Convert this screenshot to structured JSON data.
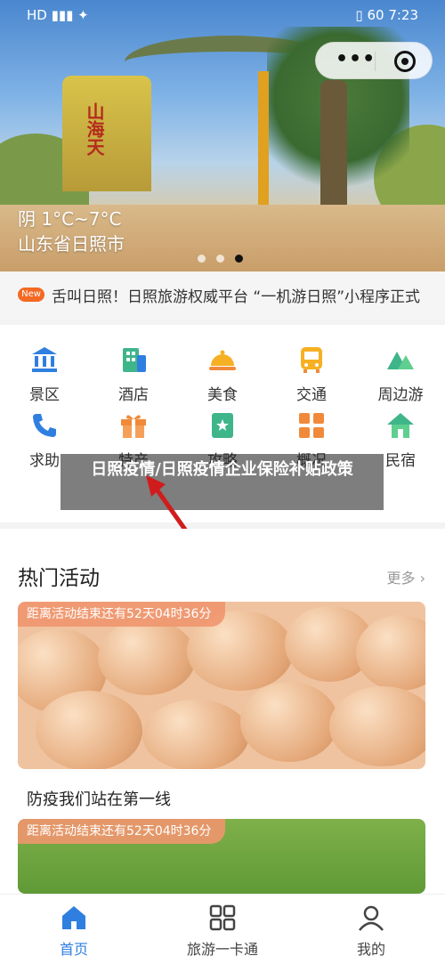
{
  "status_bar": {
    "left": "HD ▮▮▮ ✦",
    "battery": "60",
    "time": "7:23"
  },
  "capsule": {
    "menu_icon": "more-dots-icon",
    "close_icon": "target-icon"
  },
  "hero": {
    "weather": "阴 1°C~7°C",
    "city": "山东省日照市",
    "gate_text": "山海天"
  },
  "notice": {
    "badge": "New",
    "text": "舌叫日照！日照旅游权威平台 “一机游日照”小程序正式"
  },
  "grid": {
    "items": [
      {
        "label": "景区",
        "icon": "bank-icon"
      },
      {
        "label": "酒店",
        "icon": "building-icon"
      },
      {
        "label": "美食",
        "icon": "cloche-icon"
      },
      {
        "label": "交通",
        "icon": "bus-icon"
      },
      {
        "label": "周边游",
        "icon": "mountain-icon"
      },
      {
        "label": "求助",
        "icon": "phone-icon"
      },
      {
        "label": "特产",
        "icon": "gift-icon"
      },
      {
        "label": "攻略",
        "icon": "book-icon"
      },
      {
        "label": "概况",
        "icon": "tiles-icon"
      },
      {
        "label": "民宿",
        "icon": "house-icon"
      }
    ]
  },
  "overlay": {
    "text": "日照疫情/日照疫情企业保险补贴政策"
  },
  "hot": {
    "title": "热门活动",
    "more": "更多",
    "cards": [
      {
        "timer": "距离活动结束还有52天04时36分",
        "caption": "防疫我们站在第一线"
      },
      {
        "timer": "距离活动结束还有52天04时36分"
      }
    ]
  },
  "tabbar": [
    {
      "label": "首页",
      "icon": "home-icon",
      "active": true
    },
    {
      "label": "旅游一卡通",
      "icon": "grid-icon",
      "active": false
    },
    {
      "label": "我的",
      "icon": "user-icon",
      "active": false
    }
  ],
  "colors": {
    "accent": "#2f7fe0",
    "badge": "#f36a24",
    "icon_orange": "#f08a3a",
    "icon_green": "#3fb58a"
  }
}
